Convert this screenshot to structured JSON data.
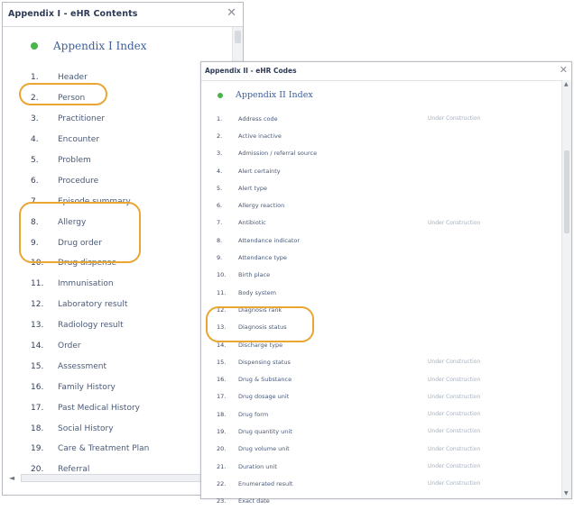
{
  "window1": {
    "title": "Appendix I - eHR Contents",
    "close_glyph": "✕",
    "index_title": "Appendix I Index",
    "items": [
      {
        "num": "1.",
        "label": "Header"
      },
      {
        "num": "2.",
        "label": "Person"
      },
      {
        "num": "3.",
        "label": "Practitioner"
      },
      {
        "num": "4.",
        "label": "Encounter"
      },
      {
        "num": "5.",
        "label": "Problem"
      },
      {
        "num": "6.",
        "label": "Procedure"
      },
      {
        "num": "7.",
        "label": "Episode summary"
      },
      {
        "num": "8.",
        "label": "Allergy"
      },
      {
        "num": "9.",
        "label": "Drug order"
      },
      {
        "num": "10.",
        "label": "Drug dispense"
      },
      {
        "num": "11.",
        "label": "Immunisation"
      },
      {
        "num": "12.",
        "label": "Laboratory result"
      },
      {
        "num": "13.",
        "label": "Radiology result"
      },
      {
        "num": "14.",
        "label": "Order"
      },
      {
        "num": "15.",
        "label": "Assessment"
      },
      {
        "num": "16.",
        "label": "Family History"
      },
      {
        "num": "17.",
        "label": "Past Medical History"
      },
      {
        "num": "18.",
        "label": "Social History"
      },
      {
        "num": "19.",
        "label": "Care & Treatment Plan"
      },
      {
        "num": "20.",
        "label": "Referral"
      }
    ],
    "scroll_left_glyph": "◄"
  },
  "window2": {
    "title": "Appendix II - eHR Codes",
    "close_glyph": "✕",
    "index_title": "Appendix II Index",
    "scroll_up_glyph": "▲",
    "scroll_down_glyph": "▼",
    "items": [
      {
        "num": "1.",
        "label": "Address code",
        "note": "Under Construction"
      },
      {
        "num": "2.",
        "label": "Active inactive",
        "note": ""
      },
      {
        "num": "3.",
        "label": "Admission / referral source",
        "note": ""
      },
      {
        "num": "4.",
        "label": "Alert certainty",
        "note": ""
      },
      {
        "num": "5.",
        "label": "Alert type",
        "note": ""
      },
      {
        "num": "6.",
        "label": "Allergy reaction",
        "note": ""
      },
      {
        "num": "7.",
        "label": "Antibiotic",
        "note": "Under Construction"
      },
      {
        "num": "8.",
        "label": "Attendance indicator",
        "note": ""
      },
      {
        "num": "9.",
        "label": "Attendance type",
        "note": ""
      },
      {
        "num": "10.",
        "label": "Birth place",
        "note": ""
      },
      {
        "num": "11.",
        "label": "Body system",
        "note": ""
      },
      {
        "num": "12.",
        "label": "Diagnosis rank",
        "note": ""
      },
      {
        "num": "13.",
        "label": "Diagnosis status",
        "note": ""
      },
      {
        "num": "14.",
        "label": "Discharge type",
        "note": ""
      },
      {
        "num": "15.",
        "label": "Dispensing status",
        "note": "Under Construction"
      },
      {
        "num": "16.",
        "label": "Drug & Substance",
        "note": "Under Construction"
      },
      {
        "num": "17.",
        "label": "Drug dosage unit",
        "note": "Under Construction"
      },
      {
        "num": "18.",
        "label": "Drug form",
        "note": "Under Construction"
      },
      {
        "num": "19.",
        "label": "Drug quantity unit",
        "note": "Under Construction"
      },
      {
        "num": "20.",
        "label": "Drug volume unit",
        "note": "Under Construction"
      },
      {
        "num": "21.",
        "label": "Duration unit",
        "note": "Under Construction"
      },
      {
        "num": "22.",
        "label": "Enumerated result",
        "note": "Under Construction"
      },
      {
        "num": "23.",
        "label": "Exact date",
        "note": ""
      }
    ]
  },
  "highlight_color": "#eaa632",
  "index_dot_color": "#49b44a"
}
